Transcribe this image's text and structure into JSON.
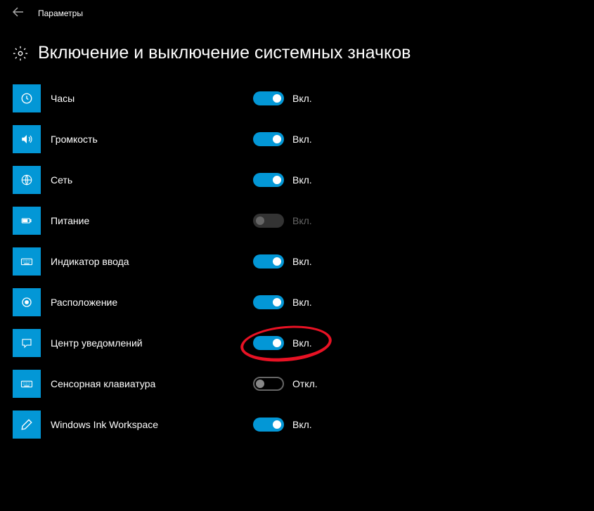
{
  "header": {
    "app_title": "Параметры"
  },
  "page": {
    "title": "Включение и выключение системных значков"
  },
  "labels": {
    "on": "Вкл.",
    "off": "Откл."
  },
  "settings": [
    {
      "id": "clock",
      "label": "Часы",
      "icon": "clock-icon",
      "state": "on",
      "enabled": true
    },
    {
      "id": "volume",
      "label": "Громкость",
      "icon": "volume-icon",
      "state": "on",
      "enabled": true
    },
    {
      "id": "network",
      "label": "Сеть",
      "icon": "network-icon",
      "state": "on",
      "enabled": true
    },
    {
      "id": "power",
      "label": "Питание",
      "icon": "power-icon",
      "state": "on",
      "enabled": false
    },
    {
      "id": "input-indicator",
      "label": "Индикатор ввода",
      "icon": "keyboard-icon",
      "state": "on",
      "enabled": true
    },
    {
      "id": "location",
      "label": "Расположение",
      "icon": "location-icon",
      "state": "on",
      "enabled": true
    },
    {
      "id": "action-center",
      "label": "Центр уведомлений",
      "icon": "notification-icon",
      "state": "on",
      "enabled": true,
      "highlighted": true
    },
    {
      "id": "touch-keyboard",
      "label": "Сенсорная клавиатура",
      "icon": "touch-keyboard-icon",
      "state": "off",
      "enabled": true
    },
    {
      "id": "windows-ink",
      "label": "Windows Ink Workspace",
      "icon": "ink-icon",
      "state": "on",
      "enabled": true
    }
  ]
}
